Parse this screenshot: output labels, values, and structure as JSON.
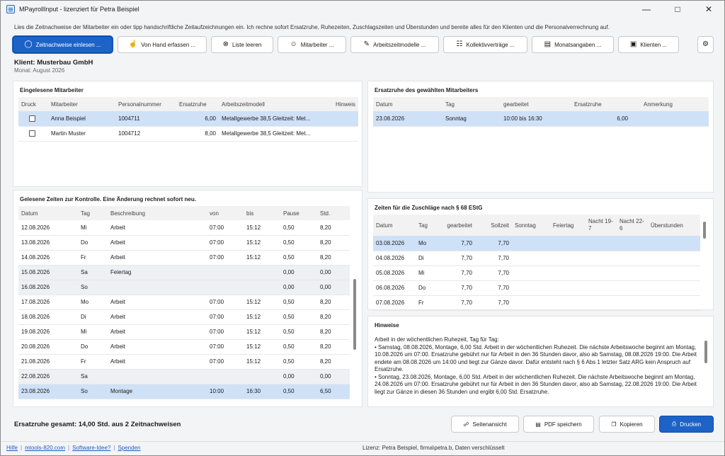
{
  "window": {
    "title": "MPayrollInput - lizenziert für Petra Beispiel"
  },
  "intro": "Lies die Zeitnachweise der Mitarbeiter ein oder tipp handschriftliche Zeitaufzeichnungen ein. Ich rechne sofort Ersatzruhe, Ruhezeiten, Zuschlagszeiten und Überstunden und bereite alles für den Klienten und die Personalverrechnung auf.",
  "toolbar": {
    "read_label": "Zeitnachweise einlesen ...",
    "manual_label": "Von Hand erfassen ...",
    "clear_label": "Liste leeren",
    "staff_label": "Mitarbeiter ...",
    "models_label": "Arbeitszeitmodelle ...",
    "kv_label": "Kollektivverträge ...",
    "monthly_label": "Monatsangaben ...",
    "clients_label": "Klienten ..."
  },
  "client": {
    "label": "Klient:",
    "name": "Musterbau GmbH",
    "month_label": "Monat:",
    "month": "August 2026"
  },
  "employees": {
    "title": "Eingelesene Mitarbeiter",
    "headers": [
      "Druck",
      "Mitarbeiter",
      "Personalnummer",
      "Ersatzruhe",
      "Arbeitszeitmodell",
      "Hinweis"
    ],
    "rows": [
      {
        "name": "Anna Beispiel",
        "nr": "1004711",
        "ersatz": "6,00",
        "modell": "Metallgewerbe 38,5 Gleitzeit: Met..."
      },
      {
        "name": "Martin Muster",
        "nr": "1004712",
        "ersatz": "8,00",
        "modell": "Metallgewerbe 38,5 Gleitzeit: Met..."
      }
    ]
  },
  "ersatzruhe": {
    "title": "Ersatzruhe des gewählten Mitarbeiters",
    "headers": [
      "Datum",
      "Tag",
      "gearbeitet",
      "Ersatzruhe",
      "Anmerkung"
    ],
    "rows": [
      {
        "datum": "23.08.2026",
        "tag": "Sonntag",
        "gearbeitet": "10:00 bis 16:30",
        "ersatz": "6,00",
        "anm": ""
      }
    ]
  },
  "times": {
    "title": "Gelesene Zeiten zur Kontrolle. Eine Änderung rechnet sofort neu.",
    "headers": [
      "Datum",
      "Tag",
      "Beschreibung",
      "von",
      "bis",
      "Pause",
      "Std."
    ],
    "rows": [
      [
        "12.08.2026",
        "Mi",
        "Arbeit",
        "07:00",
        "15:12",
        "0,50",
        "8,20"
      ],
      [
        "13.08.2026",
        "Do",
        "Arbeit",
        "07:00",
        "15:12",
        "0,50",
        "8,20"
      ],
      [
        "14.08.2026",
        "Fr",
        "Arbeit",
        "07:00",
        "15:12",
        "0,50",
        "8,20"
      ],
      [
        "15.08.2026",
        "Sa",
        "Feiertag",
        "",
        "",
        "0,00",
        "0,00"
      ],
      [
        "16.08.2026",
        "So",
        "",
        "",
        "",
        "0,00",
        "0,00"
      ],
      [
        "17.08.2026",
        "Mo",
        "Arbeit",
        "07:00",
        "15:12",
        "0,50",
        "8,20"
      ],
      [
        "18.08.2026",
        "Di",
        "Arbeit",
        "07:00",
        "15:12",
        "0,50",
        "8,20"
      ],
      [
        "19.08.2026",
        "Mi",
        "Arbeit",
        "07:00",
        "15:12",
        "0,50",
        "8,20"
      ],
      [
        "20.08.2026",
        "Do",
        "Arbeit",
        "07:00",
        "15:12",
        "0,50",
        "8,20"
      ],
      [
        "21.08.2026",
        "Fr",
        "Arbeit",
        "07:00",
        "15:12",
        "0,50",
        "8,20"
      ],
      [
        "22.08.2026",
        "Sa",
        "",
        "",
        "",
        "0,00",
        "0,00"
      ],
      [
        "23.08.2026",
        "So",
        "Montage",
        "10:00",
        "16:30",
        "0,50",
        "6,50"
      ]
    ]
  },
  "zuschlaege": {
    "title": "Zeiten für die Zuschläge nach § 68 EStG",
    "headers": [
      "Datum",
      "Tag",
      "gearbeitet",
      "Sollzeit",
      "Sonntag",
      "Feiertag",
      "Nacht 19-7",
      "Nacht 22-6",
      "Überstunden"
    ],
    "rows": [
      [
        "03.08.2026",
        "Mo",
        "7,70",
        "7,70"
      ],
      [
        "04.08.2026",
        "Di",
        "7,70",
        "7,70"
      ],
      [
        "05.08.2026",
        "Mi",
        "7,70",
        "7,70"
      ],
      [
        "06.08.2026",
        "Do",
        "7,70",
        "7,70"
      ],
      [
        "07.08.2026",
        "Fr",
        "7,70",
        "7,70"
      ]
    ]
  },
  "hinweise": {
    "title": "Hinweise",
    "lines": [
      "Arbeit in der wöchentlichen Ruhezeit, Tag für Tag:",
      "• Samstag, 08.08.2026, Montage, 6,00 Std. Arbeit in der wöchentlichen Ruhezeit. Die nächste Arbeitswoche beginnt am Montag, 10.08.2026 um 07:00. Ersatzruhe gebührt nur für Arbeit in den 36 Stunden davor, also ab Samstag, 08.08.2026 19:00. Die Arbeit endete am 08.08.2026 um 14:00 und liegt zur Gänze davor. Dafür entsteht nach § 6 Abs 1 letzter Satz ARG kein Anspruch auf Ersatzruhe.",
      "• Sonntag, 23.08.2026, Montage, 6,00 Std. Arbeit in der wöchentlichen Ruhezeit. Die nächste Arbeitswoche beginnt am Montag, 24.08.2026 um 07:00. Ersatzruhe gebührt nur für Arbeit in den 36 Stunden davor, also ab Samstag, 22.08.2026 19:00. Die Arbeit liegt zur Gänze in diesen 36 Stunden und ergibt 6,00 Std. Ersatzruhe."
    ]
  },
  "summary": "Ersatzruhe gesamt: 14,00 Std. aus 2 Zeitnachweisen",
  "bottom": {
    "preview": "Seitenansicht",
    "pdf": "PDF speichern",
    "copy": "Kopieren",
    "print": "Drucken"
  },
  "status": {
    "help": "Hilfe",
    "site": "mtools-820.com",
    "idea": "Software-Idee?",
    "donate": "Spenden",
    "license": "Lizenz: Petra Beispiel, firma\\petra.b, Daten verschlüsselt"
  }
}
